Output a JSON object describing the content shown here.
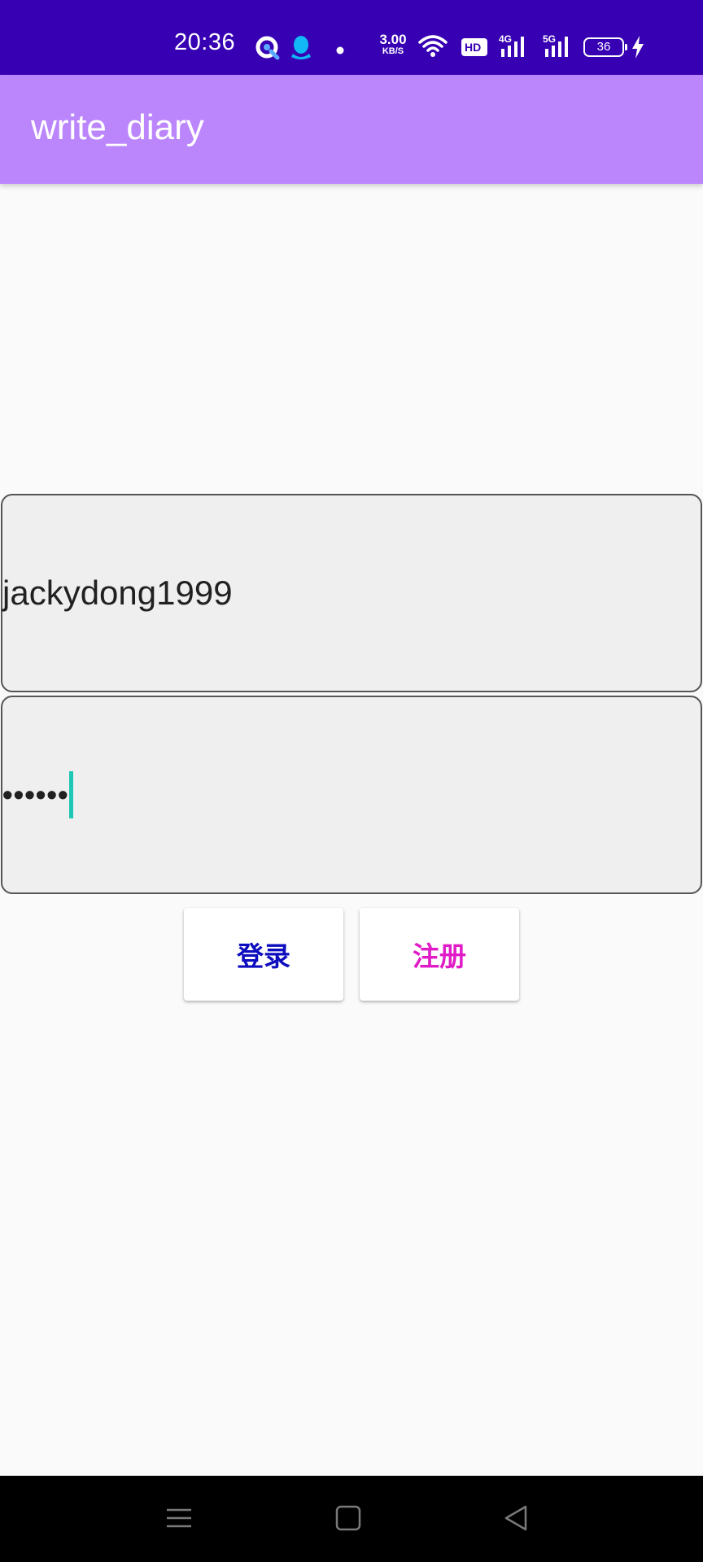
{
  "status_bar": {
    "time": "20:36",
    "net_speed_value": "3.00",
    "net_speed_unit": "KB/S",
    "battery_level": "36",
    "icons": [
      "quark-browser-icon",
      "qq-icon",
      "notification-dot-icon",
      "wifi-icon",
      "hd-icon",
      "4g-signal-icon",
      "5g-signal-icon",
      "battery-icon",
      "charging-icon"
    ],
    "background_color": "#3700b3"
  },
  "app_bar": {
    "title": "write_diary",
    "background_color": "#bb86fc"
  },
  "login_form": {
    "username_value": "jackydong1999",
    "password_mask": "••••••",
    "login_label": "登录",
    "login_color": "#0d0dbf",
    "register_label": "注册",
    "register_color": "#e01bc7"
  },
  "nav_bar": {
    "icons": [
      "menu-icon",
      "home-icon",
      "back-icon"
    ]
  }
}
